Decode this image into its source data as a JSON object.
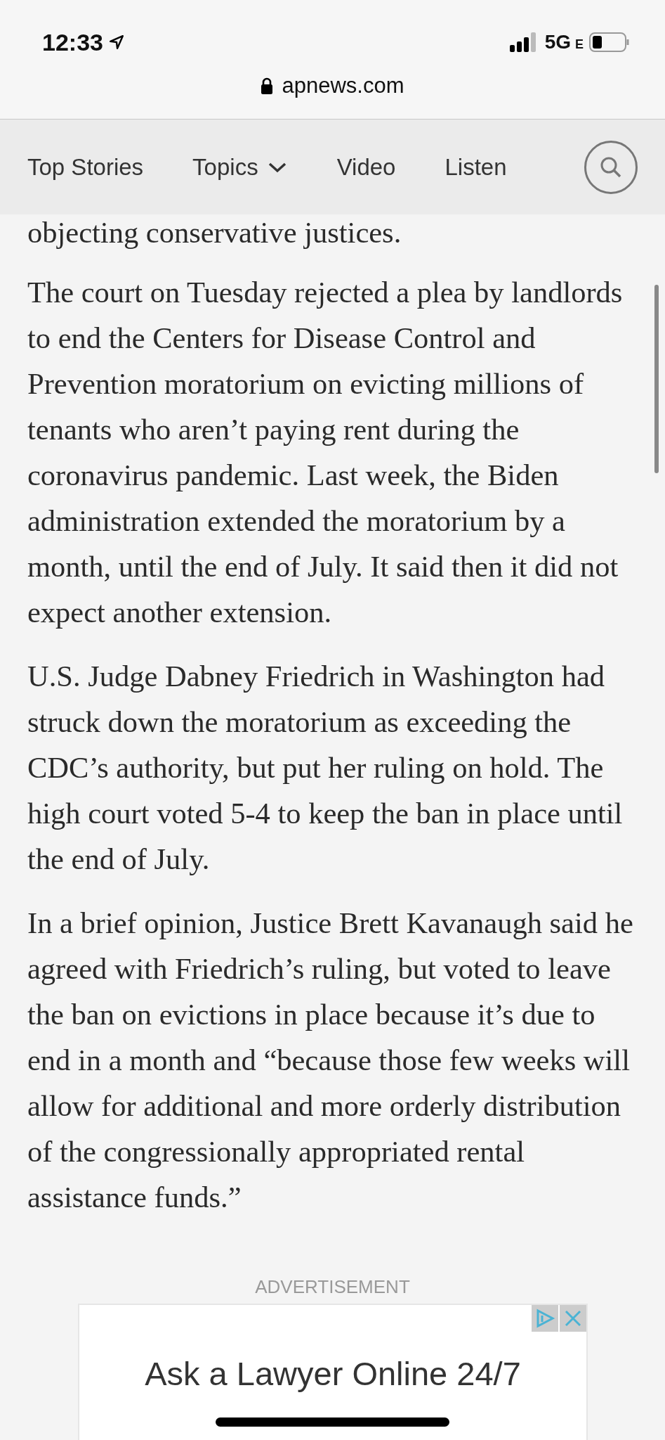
{
  "status_bar": {
    "time": "12:33",
    "network": "5G",
    "network_suffix": "E"
  },
  "browser": {
    "url": "apnews.com"
  },
  "nav": {
    "items": [
      {
        "label": "Top Stories",
        "kind": "link"
      },
      {
        "label": "Topics",
        "kind": "dropdown"
      },
      {
        "label": "Video",
        "kind": "link"
      },
      {
        "label": "Listen",
        "kind": "link"
      }
    ]
  },
  "article": {
    "cut_line": "objecting conservative justices.",
    "paragraphs": [
      "The court on Tuesday rejected a plea by landlords to end the Centers for Disease Control and Prevention moratorium on evicting millions of tenants who aren’t paying rent during the coronavirus pandemic. Last week, the Biden administration extended the moratorium by a month, until the end of July. It said then it did not expect another extension.",
      "U.S. Judge Dabney Friedrich in Washington had struck down the moratorium as exceeding the CDC’s authority, but put her ruling on hold. The high court voted 5-4 to keep the ban in place until the end of July.",
      "In a brief opinion, Justice Brett Kavanaugh said he agreed with Friedrich’s ruling, but voted to leave the ban on evictions in place because it’s due to end in a month and “because those few weeks will allow for additional and more orderly distribution of the congressionally appropriated rental assistance funds.”"
    ]
  },
  "ad": {
    "label": "ADVERTISEMENT",
    "headline": "Ask a Lawyer Online 24/7"
  }
}
